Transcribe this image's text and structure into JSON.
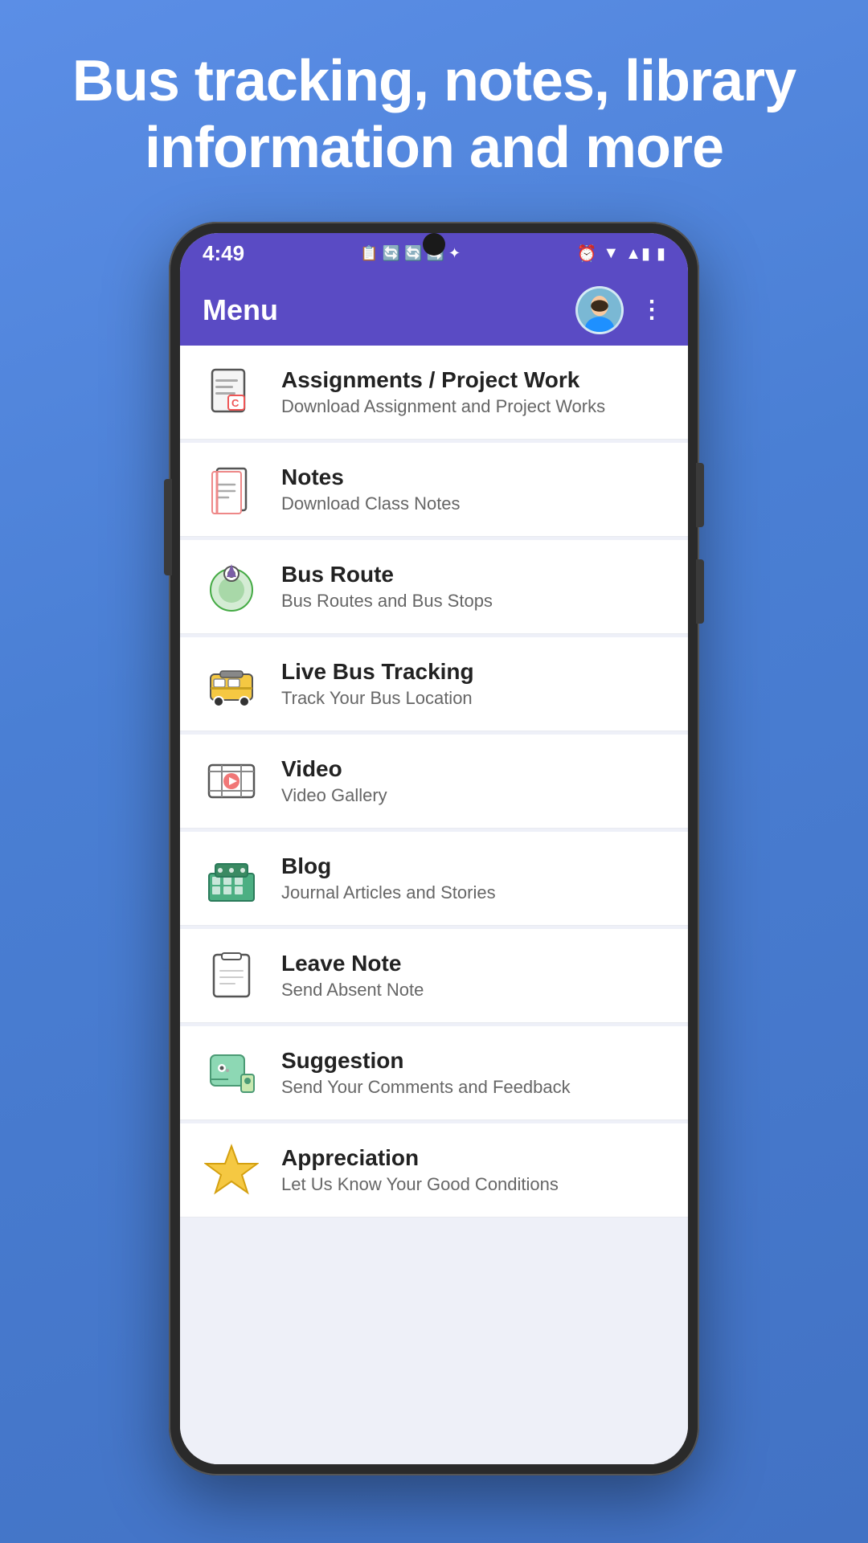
{
  "hero": {
    "text": "Bus tracking, notes, library information and more"
  },
  "statusBar": {
    "time": "4:49",
    "icons": "⏰ ▼ ✕ ▲ ▮"
  },
  "toolbar": {
    "title": "Menu",
    "moreIcon": "⋮"
  },
  "menuItems": [
    {
      "id": "assignments",
      "title": "Assignments / Project Work",
      "subtitle": "Download Assignment and Project Works",
      "iconType": "assignments"
    },
    {
      "id": "notes",
      "title": "Notes",
      "subtitle": "Download Class Notes",
      "iconType": "notes"
    },
    {
      "id": "bus-route",
      "title": "Bus Route",
      "subtitle": "Bus Routes and Bus Stops",
      "iconType": "bus-route"
    },
    {
      "id": "live-bus",
      "title": "Live Bus Tracking",
      "subtitle": "Track Your Bus Location",
      "iconType": "live-bus"
    },
    {
      "id": "video",
      "title": "Video",
      "subtitle": "Video Gallery",
      "iconType": "video"
    },
    {
      "id": "blog",
      "title": "Blog",
      "subtitle": "Journal Articles and Stories",
      "iconType": "blog"
    },
    {
      "id": "leave-note",
      "title": "Leave Note",
      "subtitle": "Send Absent Note",
      "iconType": "leave-note"
    },
    {
      "id": "suggestion",
      "title": "Suggestion",
      "subtitle": "Send Your Comments and Feedback",
      "iconType": "suggestion"
    },
    {
      "id": "appreciation",
      "title": "Appreciation",
      "subtitle": "Let Us Know Your Good Conditions",
      "iconType": "appreciation"
    }
  ]
}
